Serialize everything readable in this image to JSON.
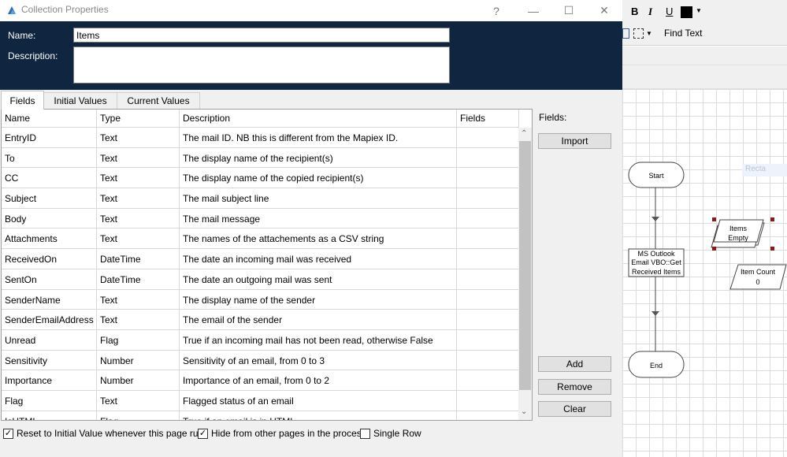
{
  "window": {
    "title": "Collection Properties",
    "help": "?",
    "minimize": "—",
    "maximize": "☐",
    "close": "✕"
  },
  "header": {
    "name_label": "Name:",
    "name_value": "Items",
    "description_label": "Description:",
    "description_value": ""
  },
  "tabs": [
    {
      "label": "Fields",
      "selected": true
    },
    {
      "label": "Initial Values",
      "selected": false
    },
    {
      "label": "Current Values",
      "selected": false
    }
  ],
  "grid": {
    "columns": [
      "Name",
      "Type",
      "Description",
      "Fields"
    ],
    "rows": [
      {
        "name": "EntryID",
        "type": "Text",
        "description": "The mail ID. NB this is different from the Mapiex ID.",
        "fields": ""
      },
      {
        "name": "To",
        "type": "Text",
        "description": "The display name of the recipient(s)",
        "fields": ""
      },
      {
        "name": "CC",
        "type": "Text",
        "description": "The display name of the copied recipient(s)",
        "fields": ""
      },
      {
        "name": "Subject",
        "type": "Text",
        "description": "The mail subject line",
        "fields": ""
      },
      {
        "name": "Body",
        "type": "Text",
        "description": "The mail message",
        "fields": ""
      },
      {
        "name": "Attachments",
        "type": "Text",
        "description": "The names of the attachements as a CSV string",
        "fields": ""
      },
      {
        "name": "ReceivedOn",
        "type": "DateTime",
        "description": "The date an incoming mail was received",
        "fields": ""
      },
      {
        "name": "SentOn",
        "type": "DateTime",
        "description": "The date an outgoing mail was sent",
        "fields": ""
      },
      {
        "name": "SenderName",
        "type": "Text",
        "description": "The display name of the sender",
        "fields": ""
      },
      {
        "name": "SenderEmailAddress",
        "type": "Text",
        "description": "The email of the sender",
        "fields": ""
      },
      {
        "name": "Unread",
        "type": "Flag",
        "description": "True if an incoming mail has not been read, otherwise False",
        "fields": ""
      },
      {
        "name": "Sensitivity",
        "type": "Number",
        "description": "Sensitivity of an email, from 0 to 3",
        "fields": ""
      },
      {
        "name": "Importance",
        "type": "Number",
        "description": "Importance of an email, from 0 to 2",
        "fields": ""
      },
      {
        "name": "Flag",
        "type": "Text",
        "description": "Flagged status of an email",
        "fields": ""
      },
      {
        "name": "IsHTML",
        "type": "Flag",
        "description": "True if an email is in HTML",
        "fields": ""
      }
    ]
  },
  "side_panel": {
    "fields_label": "Fields:",
    "import_label": "Import",
    "add_label": "Add",
    "remove_label": "Remove",
    "clear_label": "Clear"
  },
  "options": {
    "reset_label": "Reset to Initial Value whenever this page runs",
    "reset_checked": true,
    "hide_label": "Hide from other pages in the process",
    "hide_checked": true,
    "single_row_label": "Single Row",
    "single_row_checked": false
  },
  "studio": {
    "bold": "B",
    "italic": "I",
    "underline": "U",
    "find_text": "Find Text",
    "ghost_label": "Recta",
    "stages": {
      "start": "Start",
      "action_lines": [
        "MS Outlook",
        "Email VBO::Get",
        "Received Items"
      ],
      "end": "End",
      "collection_lines": [
        "Items",
        "Empty"
      ],
      "data_lines": [
        "Item Count",
        "0"
      ]
    }
  }
}
